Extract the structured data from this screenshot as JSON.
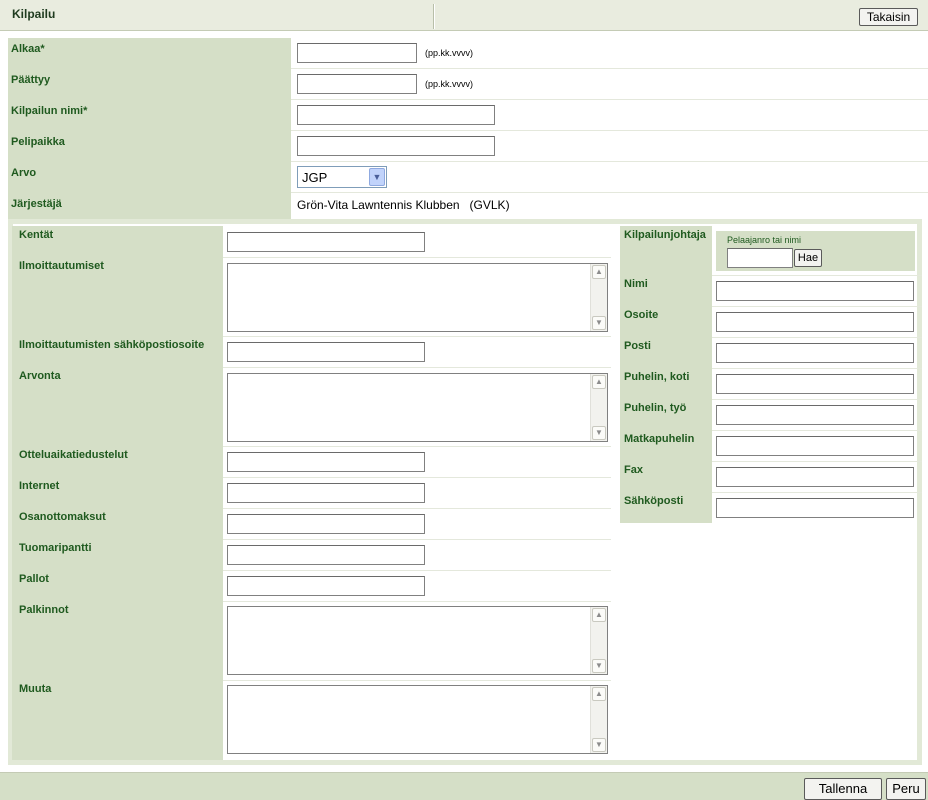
{
  "header": {
    "title": "Kilpailu",
    "back_label": "Takaisin"
  },
  "competition": {
    "start_label": "Alkaa*",
    "start_value": "",
    "start_hint": "(pp.kk.vvvv)",
    "end_label": "Päättyy",
    "end_value": "",
    "end_hint": "(pp.kk.vvvv)",
    "name_label": "Kilpailun nimi*",
    "name_value": "",
    "venue_label": "Pelipaikka",
    "venue_value": "",
    "rank_label": "Arvo",
    "rank_selected": "JGP",
    "organizer_label": "Järjestäjä",
    "organizer_value": "Grön-Vita Lawntennis Klubben   (GVLK)"
  },
  "details": {
    "courts_label": "Kentät",
    "registrations_label": "Ilmoittautumiset",
    "registration_email_label": "Ilmoittautumisten sähköpostiosoite",
    "draw_label": "Arvonta",
    "match_time_label": "Otteluaikatiedustelut",
    "internet_label": "Internet",
    "fees_label": "Osanottomaksut",
    "referee_deposit_label": "Tuomaripantti",
    "balls_label": "Pallot",
    "prizes_label": "Palkinnot",
    "other_label": "Muuta"
  },
  "director": {
    "section_label": "Kilpailunjohtaja",
    "search_hint": "Pelaajanro tai nimi",
    "search_value": "",
    "search_button": "Hae",
    "name_label": "Nimi",
    "address_label": "Osoite",
    "post_label": "Posti",
    "phone_home_label": "Puhelin, koti",
    "phone_work_label": "Puhelin, työ",
    "mobile_label": "Matkapuhelin",
    "fax_label": "Fax",
    "email_label": "Sähköposti"
  },
  "footer": {
    "save_label": "Tallenna",
    "cancel_label": "Peru"
  },
  "colors": {
    "label_bg": "#d5dfc7",
    "label_text": "#1f5a1f",
    "header_bg": "#e9ecdf"
  },
  "icons": {
    "select_arrow": "chevron-down-icon",
    "scroll_up": "scroll-up-icon",
    "scroll_down": "scroll-down-icon"
  }
}
